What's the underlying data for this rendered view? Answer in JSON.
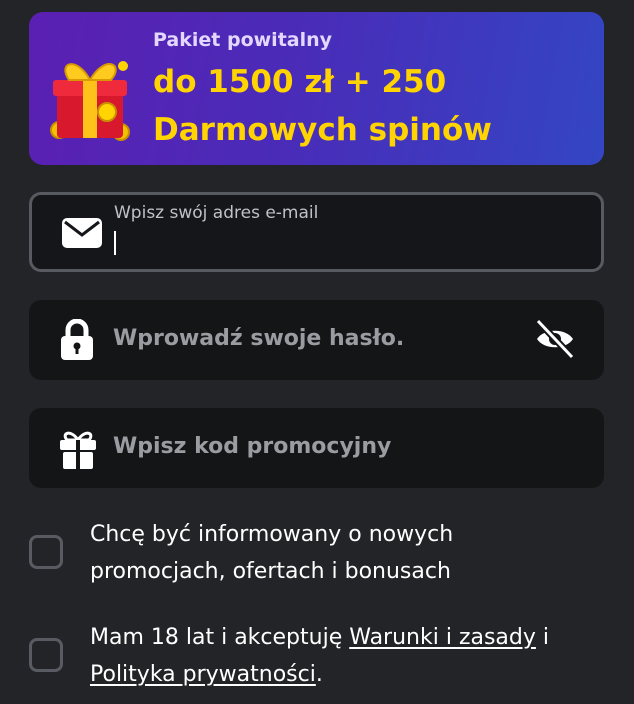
{
  "banner": {
    "subtitle": "Pakiet powitalny",
    "title_line1": "do 1500 zł + 250",
    "title_line2": "Darmowych spinów",
    "gift_icon": "gift-box-coins-icon",
    "accent_color": "#ffd400"
  },
  "email": {
    "label": "Wpisz swój adres e-mail",
    "value": "",
    "icon": "envelope-icon"
  },
  "password": {
    "placeholder": "Wprowadź swoje hasło.",
    "icon": "lock-icon",
    "toggle_icon": "eye-slash-icon"
  },
  "promo": {
    "placeholder": "Wpisz kod promocyjny",
    "icon": "gift-icon"
  },
  "consents": {
    "newsletter": {
      "line1": "Chcę być informowany o nowych",
      "line2": "promocjach, ofertach i bonusach",
      "checked": false
    },
    "terms": {
      "text_before": "Mam 18 lat i akceptuję ",
      "terms_link": "Warunki i zasady",
      "text_middle": " i",
      "privacy_link": "Polityka prywatności",
      "text_after": ".",
      "checked": false
    }
  }
}
